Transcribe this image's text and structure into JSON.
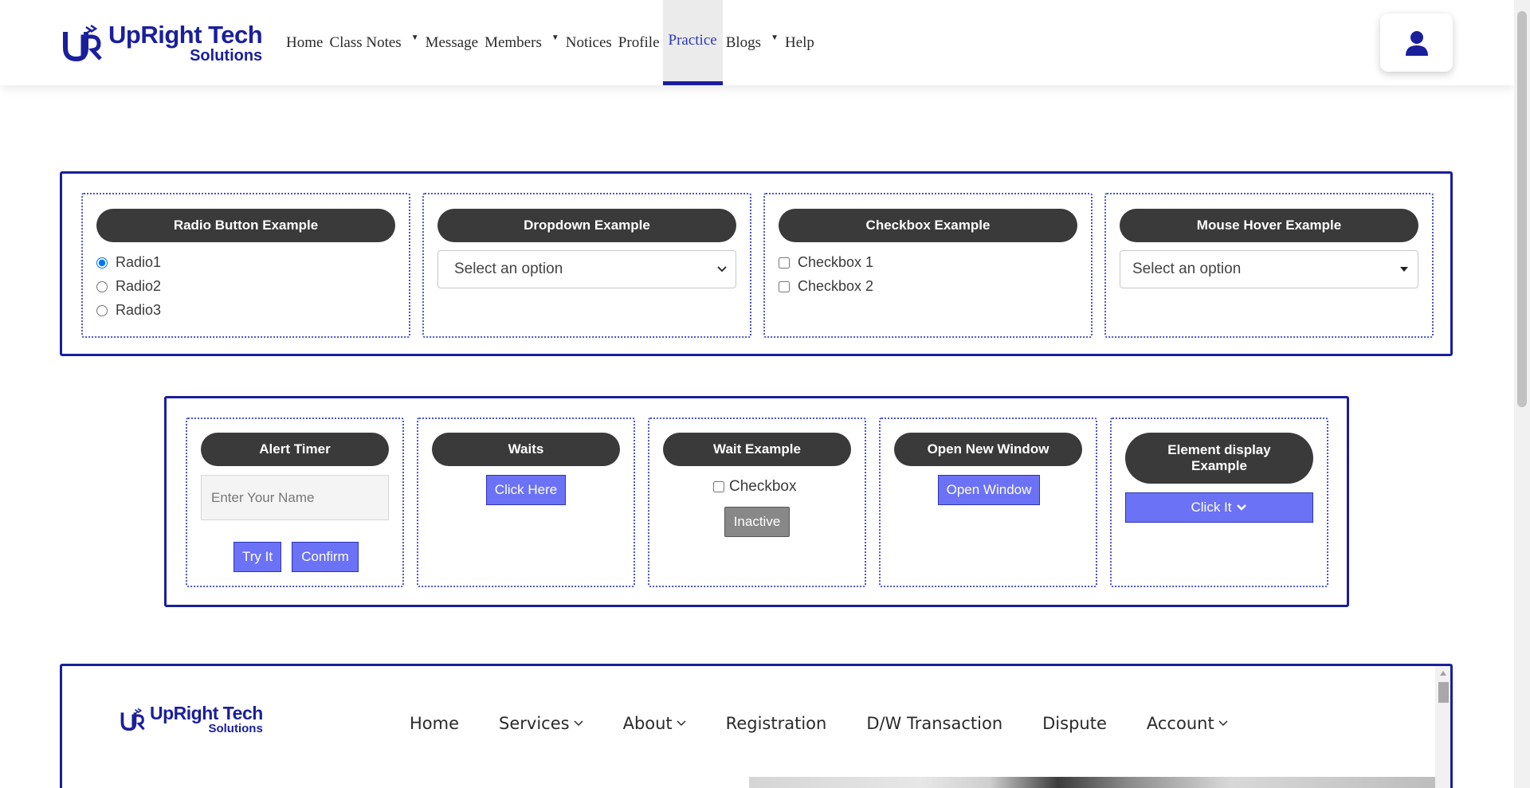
{
  "brand": {
    "line1": "UpRight Tech",
    "line2": "Solutions"
  },
  "nav": {
    "items": [
      {
        "label": "Home"
      },
      {
        "label": "Class Notes"
      },
      {
        "label": "Message"
      },
      {
        "label": "Members"
      },
      {
        "label": "Notices"
      },
      {
        "label": "Profile"
      },
      {
        "label": "Practice"
      },
      {
        "label": "Blogs"
      },
      {
        "label": "Help"
      }
    ],
    "active": "Practice"
  },
  "section1": {
    "radio": {
      "title": "Radio Button Example",
      "options": [
        "Radio1",
        "Radio2",
        "Radio3"
      ],
      "selected": "Radio1"
    },
    "dropdown": {
      "title": "Dropdown Example",
      "value": "Select an option"
    },
    "checkbox": {
      "title": "Checkbox Example",
      "options": [
        "Checkbox 1",
        "Checkbox 2"
      ]
    },
    "hover": {
      "title": "Mouse Hover Example",
      "value": "Select an option"
    }
  },
  "section2": {
    "alert": {
      "title": "Alert Timer",
      "placeholder": "Enter Your Name",
      "try_label": "Try It",
      "confirm_label": "Confirm"
    },
    "waits": {
      "title": "Waits",
      "button_label": "Click Here"
    },
    "wait_example": {
      "title": "Wait Example",
      "checkbox_label": "Checkbox",
      "button_label": "Inactive"
    },
    "new_window": {
      "title": "Open New Window",
      "button_label": "Open Window"
    },
    "element_display": {
      "title": "Element display Example",
      "button_label": "Click It"
    }
  },
  "embedded": {
    "brand": {
      "line1": "UpRight Tech",
      "line2": "Solutions"
    },
    "nav": [
      {
        "label": "Home"
      },
      {
        "label": "Services"
      },
      {
        "label": "About"
      },
      {
        "label": "Registration"
      },
      {
        "label": "D/W Transaction"
      },
      {
        "label": "Dispute"
      },
      {
        "label": "Account"
      }
    ]
  },
  "colors": {
    "brand": "#1a1f9c",
    "accent_button": "#6b72f5",
    "pill": "#3a3a3a",
    "active_nav": "#2c39b7"
  }
}
